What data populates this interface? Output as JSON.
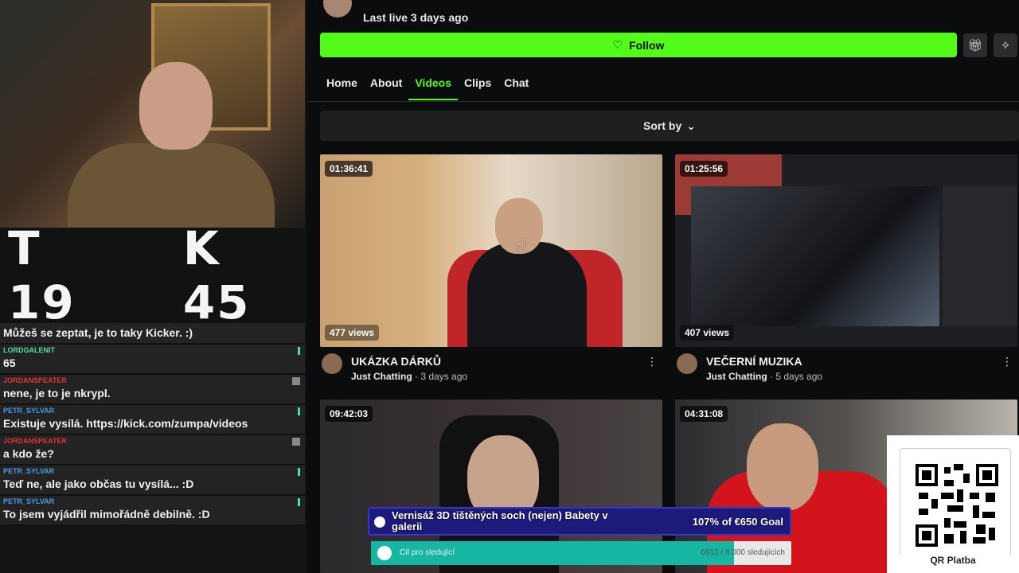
{
  "stream_overlay": {
    "counter": {
      "left": "T 19",
      "right": "K 45"
    },
    "chat": [
      {
        "user": "",
        "user_color": "#ffffff",
        "text": "Můžeš se zeptat, je to taky Kicker. :)"
      },
      {
        "user": "LORDGALENIT",
        "user_color": "#48e0a0",
        "text": "65"
      },
      {
        "user": "JORDANSPEATER",
        "user_color": "#e23333",
        "text": "nene, je to je nkrypl."
      },
      {
        "user": "PETR_SYLVAR",
        "user_color": "#4a9be8",
        "text": "Existuje vysílá. https://kick.com/zumpa/videos"
      },
      {
        "user": "JORDANSPEATER",
        "user_color": "#e23333",
        "text": "a kdo že?"
      },
      {
        "user": "PETR_SYLVAR",
        "user_color": "#4a9be8",
        "text": "Teď ne, ale jako občas tu vysílá... :D"
      },
      {
        "user": "PETR_SYLVAR",
        "user_color": "#4a9be8",
        "text": "To jsem vyjádřil mimořádně debilně. :D"
      }
    ]
  },
  "channel": {
    "last_live": "Last live 3 days ago",
    "follow_label": "Follow",
    "accent": "#53fc18"
  },
  "tabs": [
    {
      "label": "Home",
      "active": false
    },
    {
      "label": "About",
      "active": false
    },
    {
      "label": "Videos",
      "active": true
    },
    {
      "label": "Clips",
      "active": false
    },
    {
      "label": "Chat",
      "active": false
    }
  ],
  "sort_label": "Sort by",
  "videos": [
    {
      "duration": "01:36:41",
      "views": "477 views",
      "title": "UKÁZKA DÁRKŮ",
      "category": "Just Chatting",
      "age": "· 3 days ago"
    },
    {
      "duration": "01:25:56",
      "views": "407 views",
      "title": "VEČERNÍ MUZIKA",
      "category": "Just Chatting",
      "age": "· 5 days ago"
    },
    {
      "duration": "09:42:03",
      "views": "",
      "title": "",
      "category": "",
      "age": ""
    },
    {
      "duration": "04:31:08",
      "views": "",
      "title": "",
      "category": "",
      "age": ""
    }
  ],
  "goal_overlay": {
    "title": "Vernisáž 3D tištěných soch (nejen) Babety v galerii",
    "progress": "107% of €650 Goal",
    "follow_goal_label": "Cíl pro sledující",
    "follow_goal_count": "6913 / 8 000 sledujících",
    "follow_goal_fraction": 0.864
  },
  "qr_label": "QR Platba"
}
